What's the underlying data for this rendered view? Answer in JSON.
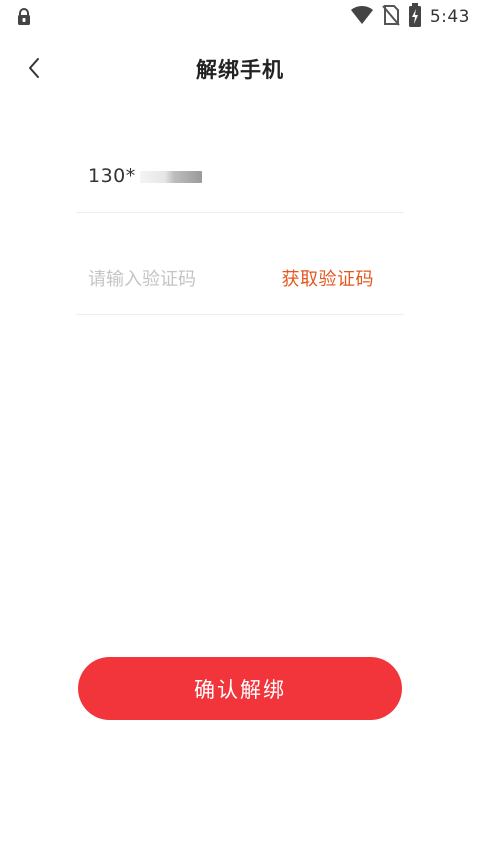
{
  "status_bar": {
    "time": "5:43",
    "icons": [
      "lock-icon",
      "wifi-icon",
      "no-sim-icon",
      "battery-charging-icon"
    ]
  },
  "header": {
    "back_icon": "chevron-left-icon",
    "title": "解绑手机"
  },
  "phone": {
    "prefix": "130*"
  },
  "code": {
    "placeholder": "请输入验证码",
    "value": "",
    "get_code_label": "获取验证码"
  },
  "confirm": {
    "label": "确认解绑"
  },
  "colors": {
    "accent": "#f2353b",
    "link": "#e4571f",
    "text": "#333333",
    "placeholder": "#c4c4c4",
    "divider": "#eeeeee"
  }
}
